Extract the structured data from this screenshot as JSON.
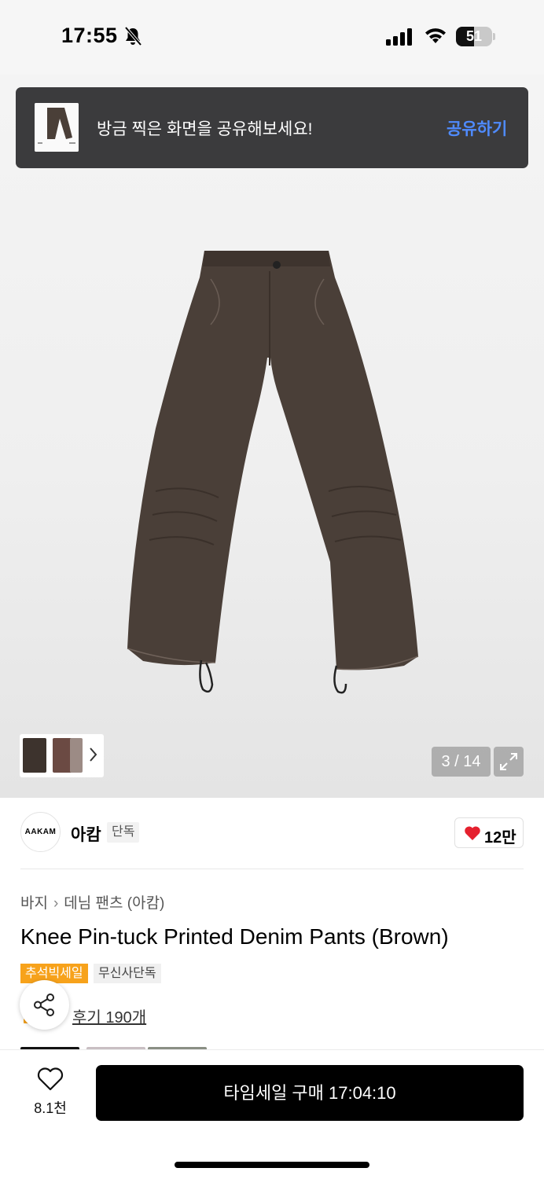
{
  "status_bar": {
    "time": "17:55",
    "battery": "51",
    "battery_level": 0.51
  },
  "toast": {
    "message": "방금 찍은 화면을 공유해보세요!",
    "action": "공유하기"
  },
  "gallery": {
    "counter": "3 / 14"
  },
  "brand": {
    "logo_text": "AAKAM",
    "name": "아캄",
    "tag": "단독"
  },
  "like": {
    "count": "12만"
  },
  "breadcrumb": {
    "category": "바지",
    "subcategory": "데님 팬츠 (아캄)"
  },
  "product": {
    "title": "Knee Pin-tuck Printed Denim Pants (Brown)"
  },
  "tags": {
    "sale": "추석빅세일",
    "exclusive": "무신사단독"
  },
  "reviews": {
    "label": "후기 190개"
  },
  "bottom_bar": {
    "wish_count": "8.1천",
    "buy_label": "타임세일 구매 17:04:10"
  },
  "colors": {
    "accent_sale": "#f7a21b",
    "share_blue": "#4f8bff",
    "heart_red": "#e5202e",
    "pants_brown": "#4a3f38"
  },
  "icons": [
    "bell-slash-icon",
    "signal-icon",
    "wifi-icon",
    "battery-icon",
    "chevron-right-icon",
    "expand-icon",
    "heart-icon",
    "share-icon"
  ]
}
